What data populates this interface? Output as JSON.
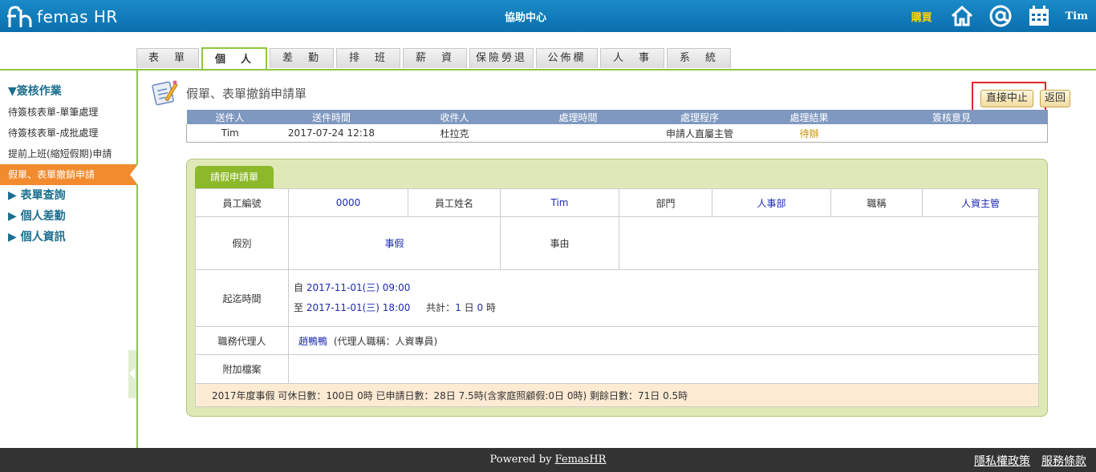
{
  "header": {
    "logo_text": "femas HR",
    "center_title": "協助中心",
    "buy_label": "購買",
    "username": "Tim"
  },
  "tabs": [
    "表　單",
    "個　人",
    "差　勤",
    "排　班",
    "薪　資",
    "保險勞退",
    "公佈欄",
    "人　事",
    "系　統"
  ],
  "sidebar": {
    "section_sign": "▼簽核作業",
    "items": [
      "待簽核表單-單筆處理",
      "待簽核表單-成批處理",
      "提前上班(縮短假期)申請",
      "假單、表單撤銷申請"
    ],
    "section_query": "▶ 表單查詢",
    "section_attendance": "▶ 個人差勤",
    "section_info": "▶ 個人資訊"
  },
  "main": {
    "title": "假單、表單撤銷申請單",
    "stop_button": "直接中止",
    "back_button": "返回"
  },
  "process_table": {
    "headers": [
      "送件人",
      "送件時間",
      "收件人",
      "處理時間",
      "處理程序",
      "處理結果",
      "簽核意見"
    ],
    "row": [
      "Tim",
      "2017-07-24 12:18",
      "杜拉克",
      "",
      "申請人直屬主管",
      "待辦",
      ""
    ]
  },
  "form": {
    "panel_tab": "請假申請單",
    "emp_no_label": "員工編號",
    "emp_no": "0000",
    "emp_name_label": "員工姓名",
    "emp_name": "Tim",
    "dept_label": "部門",
    "dept": "人事部",
    "title_label": "職稱",
    "title": "人資主管",
    "leave_type_label": "假別",
    "leave_type": "事假",
    "reason_label": "事由",
    "reason": "",
    "period_label": "起迄時間",
    "from_prefix": "自",
    "from": "2017-11-01(三) 09:00",
    "to_prefix": "至",
    "to": "2017-11-01(三) 18:00",
    "total_label": "共計：",
    "total_days": "1",
    "day_unit": "日",
    "total_hours": "0",
    "hour_unit": "時",
    "agent_label": "職務代理人",
    "agent": "趙鴨鴨",
    "agent_note": "(代理人職稱：人資專員)",
    "attach_label": "附加檔案",
    "summary": "2017年度事假  可休日數：100日 0時  已申請日數：28日 7.5時(含家庭照顧假:0日 0時)  剩餘日數：71日 0.5時"
  },
  "footer": {
    "powered_prefix": "Powered by ",
    "powered_brand": "FemasHR",
    "privacy": "隱私權政策",
    "terms": "服務條款"
  },
  "colors": {
    "header_blue": "#0b6fae",
    "accent_green": "#8ec63f",
    "active_orange": "#f28a2e",
    "highlight_red": "#e0262b"
  }
}
